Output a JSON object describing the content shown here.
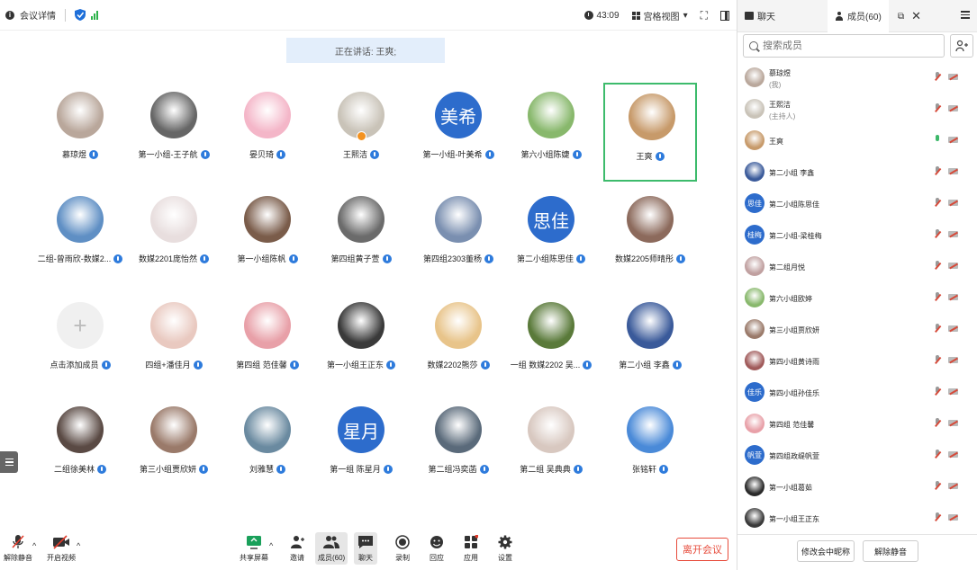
{
  "topbar": {
    "meeting_info": "会议详情",
    "timer": "43:09",
    "view_mode": "宫格视图"
  },
  "speaking": "正在讲话: 王爽;",
  "grid": [
    {
      "name": "慕琼煜",
      "avatar": {
        "type": "photo",
        "color": "#b9a79b"
      }
    },
    {
      "name": "第一小组-王子航",
      "avatar": {
        "type": "photo",
        "color": "#666666"
      }
    },
    {
      "name": "晏贝琦",
      "avatar": {
        "type": "photo",
        "color": "#f4b6c8"
      }
    },
    {
      "name": "王熙洁",
      "avatar": {
        "type": "photo",
        "color": "#c9c3b8"
      }
    },
    {
      "name": "第一小组-叶美希",
      "avatar": {
        "type": "text",
        "text": "美希"
      }
    },
    {
      "name": "第六小组陈婕",
      "avatar": {
        "type": "photo",
        "color": "#88b86c"
      }
    },
    {
      "name": "王爽",
      "avatar": {
        "type": "photo",
        "color": "#c79a6a"
      }
    },
    {
      "name": "二组-曾雨欣-数媒2...",
      "avatar": {
        "type": "photo",
        "color": "#5f8fc4"
      }
    },
    {
      "name": "数媒2201庞怡然",
      "avatar": {
        "type": "photo",
        "color": "#e8dede"
      }
    },
    {
      "name": "第一小组陈帆",
      "avatar": {
        "type": "photo",
        "color": "#7a5c4a"
      }
    },
    {
      "name": "第四组黄子萱",
      "avatar": {
        "type": "photo",
        "color": "#6b6b6b"
      }
    },
    {
      "name": "第四组2303董杨",
      "avatar": {
        "type": "photo",
        "color": "#7a8fb0"
      }
    },
    {
      "name": "第二小组陈思佳",
      "avatar": {
        "type": "text",
        "text": "思佳"
      }
    },
    {
      "name": "数媒2205师晴彤",
      "avatar": {
        "type": "photo",
        "color": "#8c6a5c"
      }
    },
    {
      "name": "点击添加成员",
      "avatar": {
        "type": "add",
        "text": "+"
      }
    },
    {
      "name": "四组+潘佳月",
      "avatar": {
        "type": "photo",
        "color": "#e9c9c0"
      }
    },
    {
      "name": "第四组 范佳馨",
      "avatar": {
        "type": "photo",
        "color": "#e8a0a8"
      }
    },
    {
      "name": "第一小组王正东",
      "avatar": {
        "type": "photo",
        "color": "#3a3a3a"
      }
    },
    {
      "name": "数媒2202熊莎",
      "avatar": {
        "type": "photo",
        "color": "#e8c48a"
      }
    },
    {
      "name": "一组 数媒2202 吴...",
      "avatar": {
        "type": "photo",
        "color": "#5a7a3a"
      }
    },
    {
      "name": "第二小组 李鑫",
      "avatar": {
        "type": "photo",
        "color": "#3a5a9a"
      }
    },
    {
      "name": "二组徐美林",
      "avatar": {
        "type": "photo",
        "color": "#5a4a44"
      }
    },
    {
      "name": "第三小组贾欣妍",
      "avatar": {
        "type": "photo",
        "color": "#9a7a6a"
      }
    },
    {
      "name": "刘雅慧",
      "avatar": {
        "type": "photo",
        "color": "#6a8aa0"
      }
    },
    {
      "name": "第一组 陈星月",
      "avatar": {
        "type": "text",
        "text": "星月"
      }
    },
    {
      "name": "第二组冯奕菡",
      "avatar": {
        "type": "photo",
        "color": "#5a6a7a"
      }
    },
    {
      "name": "第二组 吴典典",
      "avatar": {
        "type": "photo",
        "color": "#d8c8c0"
      }
    },
    {
      "name": "张铭轩",
      "avatar": {
        "type": "photo",
        "color": "#4a8ad8"
      }
    }
  ],
  "bottombar": {
    "unmute": "解除静音",
    "start_video": "开启视频",
    "share": "共享屏幕",
    "invite": "邀请",
    "members": "成员(60)",
    "chat": "聊天",
    "record": "录制",
    "react": "回应",
    "apps": "应用",
    "settings": "设置",
    "leave": "离开会议"
  },
  "panel": {
    "tab_chat": "聊天",
    "tab_members": "成员(60)",
    "search_placeholder": "搜索成员",
    "members": [
      {
        "name": "慕琼煜",
        "sub": "(我)",
        "avatar": {
          "type": "photo",
          "color": "#b9a79b"
        },
        "mic_on": false
      },
      {
        "name": "王熙洁",
        "sub": "(主持人)",
        "avatar": {
          "type": "photo",
          "color": "#c9c3b8"
        },
        "mic_on": false
      },
      {
        "name": "王爽",
        "sub": "",
        "avatar": {
          "type": "photo",
          "color": "#c79a6a"
        },
        "mic_on": true
      },
      {
        "name": "第二小组 李鑫",
        "sub": "",
        "avatar": {
          "type": "photo",
          "color": "#3a5a9a"
        },
        "mic_on": false
      },
      {
        "name": "第二小组陈思佳",
        "sub": "",
        "avatar": {
          "type": "text",
          "text": "思佳"
        },
        "mic_on": false
      },
      {
        "name": "第二小组-梁桂梅",
        "sub": "",
        "avatar": {
          "type": "text",
          "text": "桂梅"
        },
        "mic_on": false
      },
      {
        "name": "第二组月悦",
        "sub": "",
        "avatar": {
          "type": "photo",
          "color": "#c0a0a0"
        },
        "mic_on": false
      },
      {
        "name": "第六小组欧婷",
        "sub": "",
        "avatar": {
          "type": "photo",
          "color": "#88b86c"
        },
        "mic_on": false
      },
      {
        "name": "第三小组贾欣妍",
        "sub": "",
        "avatar": {
          "type": "photo",
          "color": "#9a7a6a"
        },
        "mic_on": false
      },
      {
        "name": "第四小组黄诗雨",
        "sub": "",
        "avatar": {
          "type": "photo",
          "color": "#a05a5a"
        },
        "mic_on": false
      },
      {
        "name": "第四小组孙佳乐",
        "sub": "",
        "avatar": {
          "type": "text",
          "text": "佳乐"
        },
        "mic_on": false
      },
      {
        "name": "第四组 范佳馨",
        "sub": "",
        "avatar": {
          "type": "photo",
          "color": "#e8a0a8"
        },
        "mic_on": false
      },
      {
        "name": "第四组政缇帆萱",
        "sub": "",
        "avatar": {
          "type": "text",
          "text": "帆萱"
        },
        "mic_on": false
      },
      {
        "name": "第一小组葛茹",
        "sub": "",
        "avatar": {
          "type": "photo",
          "color": "#2a2a2a"
        },
        "mic_on": false
      },
      {
        "name": "第一小组王正东",
        "sub": "",
        "avatar": {
          "type": "photo",
          "color": "#3a3a3a"
        },
        "mic_on": false
      }
    ],
    "rename": "修改会中昵称",
    "unmute_all": "解除静音"
  }
}
